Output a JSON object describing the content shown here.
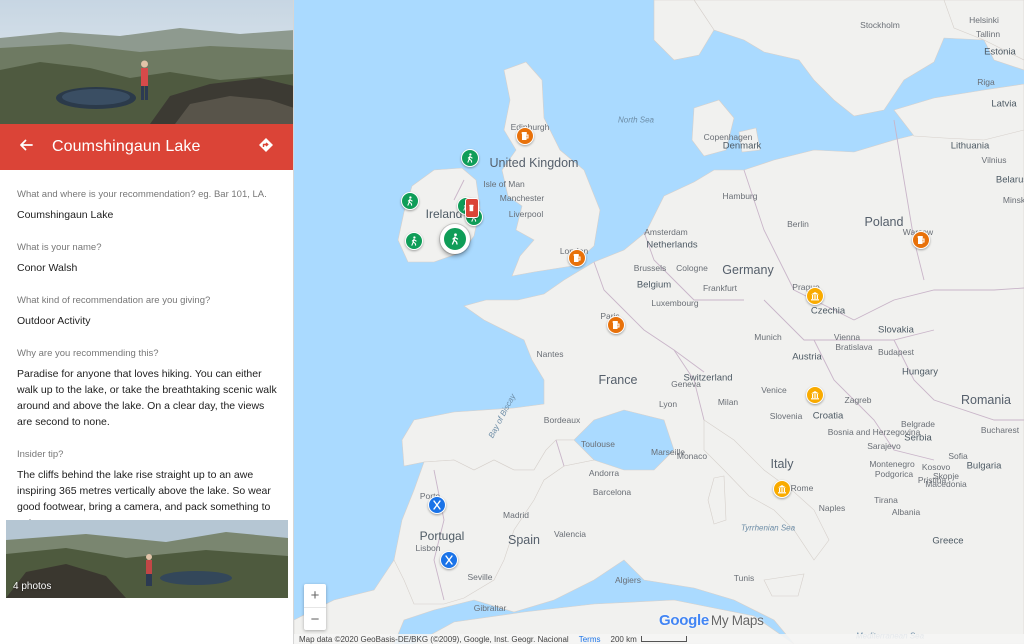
{
  "panel": {
    "title": "Coumshingaun Lake",
    "accent": "#db4437",
    "fields": [
      {
        "label": "What and where is your recommendation? eg. Bar 101, LA.",
        "value": "Coumshingaun Lake"
      },
      {
        "label": "What is your name?",
        "value": "Conor Walsh"
      },
      {
        "label": "What kind of recommendation are you giving?",
        "value": "Outdoor Activity"
      },
      {
        "label": "Why are you recommending this?",
        "value": "Paradise for anyone that loves hiking. You can either walk up to the lake, or take the breathtaking scenic walk around and above the lake. On a clear day, the views are second to none."
      },
      {
        "label": "Insider tip?",
        "value": "The cliffs behind the lake rise straight up to an awe inspiring 365 metres vertically above the lake. So wear good footwear, bring a camera, and pack something to eat."
      }
    ],
    "photo_count": "4 photos",
    "back_icon": "arrow-left-icon",
    "directions_icon": "directions-icon"
  },
  "map": {
    "countries": [
      "United Kingdom",
      "Ireland",
      "France",
      "Germany",
      "Poland",
      "Spain",
      "Portugal",
      "Italy",
      "Romania",
      "Czechia",
      "Slovakia",
      "Austria",
      "Hungary",
      "Switzerland",
      "Belgium",
      "Netherlands",
      "Luxembourg",
      "Denmark",
      "Lithuania",
      "Latvia",
      "Estonia",
      "Croatia",
      "Serbia",
      "Bosnia and Herzegovina",
      "Montenegro",
      "Kosovo",
      "Albania",
      "Greece",
      "Slovenia",
      "Bulgaria",
      "Andorra",
      "Monaco",
      "Macedonia",
      "Belarus"
    ],
    "cities": [
      "Stockholm",
      "Copenhagen",
      "Hamburg",
      "Manchester",
      "Liverpool",
      "Isle of Man",
      "Edinburgh",
      "London",
      "Brussels",
      "Cologne",
      "Frankfurt",
      "Paris",
      "Munich",
      "Vienna",
      "Bratislava",
      "Budapest",
      "Prague",
      "Berlin",
      "Warsaw",
      "Milan",
      "Venice",
      "Zagreb",
      "Belgrade",
      "Bucharest",
      "Sofia",
      "Rome",
      "Naples",
      "Barcelona",
      "Madrid",
      "Valencia",
      "Lisbon",
      "Porto",
      "Seville",
      "Gibraltar",
      "Algiers",
      "Tunis",
      "Tirana",
      "Skopje",
      "Sarajevo",
      "Podgorica",
      "Pristina",
      "Vilnius",
      "Riga",
      "Helsinki",
      "Tallinn",
      "Minsk",
      "Lyon",
      "Marseille",
      "Geneva",
      "Bordeaux",
      "Toulouse",
      "Nantes",
      "Amsterdam",
      "Luxembourg"
    ],
    "seas": [
      "North Sea",
      "Bay of Biscay",
      "Tyrrhenian Sea",
      "Mediterranean Sea"
    ],
    "markers": [
      {
        "type": "outdoor",
        "color": "#0f9d58",
        "icon": "hiker-icon",
        "selected": true
      },
      {
        "type": "outdoor",
        "color": "#0f9d58",
        "icon": "hiker-icon"
      },
      {
        "type": "outdoor",
        "color": "#0f9d58",
        "icon": "hiker-icon"
      },
      {
        "type": "outdoor",
        "color": "#0f9d58",
        "icon": "hiker-icon"
      },
      {
        "type": "outdoor",
        "color": "#0f9d58",
        "icon": "hiker-icon"
      },
      {
        "type": "outdoor",
        "color": "#0f9d58",
        "icon": "hiker-icon"
      },
      {
        "type": "bar",
        "color": "#e8710a",
        "icon": "beer-icon"
      },
      {
        "type": "bar",
        "color": "#e8710a",
        "icon": "beer-icon"
      },
      {
        "type": "bar",
        "color": "#e8710a",
        "icon": "beer-icon"
      },
      {
        "type": "bar",
        "color": "#e8710a",
        "icon": "beer-icon"
      },
      {
        "type": "bar",
        "color": "#db4437",
        "icon": "beer-icon"
      },
      {
        "type": "museum",
        "color": "#f9ab00",
        "icon": "museum-icon"
      },
      {
        "type": "museum",
        "color": "#f9ab00",
        "icon": "museum-icon"
      },
      {
        "type": "museum",
        "color": "#f9ab00",
        "icon": "museum-icon"
      },
      {
        "type": "restaurant",
        "color": "#1a73e8",
        "icon": "fork-knife-icon"
      },
      {
        "type": "restaurant",
        "color": "#1a73e8",
        "icon": "fork-knife-icon"
      },
      {
        "type": "outdoor",
        "color": "#0f9d58",
        "icon": "hiker-icon"
      },
      {
        "type": "restaurant",
        "color": "#1a73e8",
        "icon": "fork-knife-icon"
      }
    ],
    "zoom_in": "+",
    "zoom_out": "−",
    "brand_google": "Google",
    "brand_mymaps": "My Maps",
    "attribution": "Map data ©2020 GeoBasis-DE/BKG (©2009), Google, Inst. Geogr. Nacional",
    "terms": "Terms",
    "scale": "200 km",
    "colors": {
      "water": "#aadaff",
      "land": "#f1f1ef",
      "border": "#c9b5c9"
    }
  }
}
